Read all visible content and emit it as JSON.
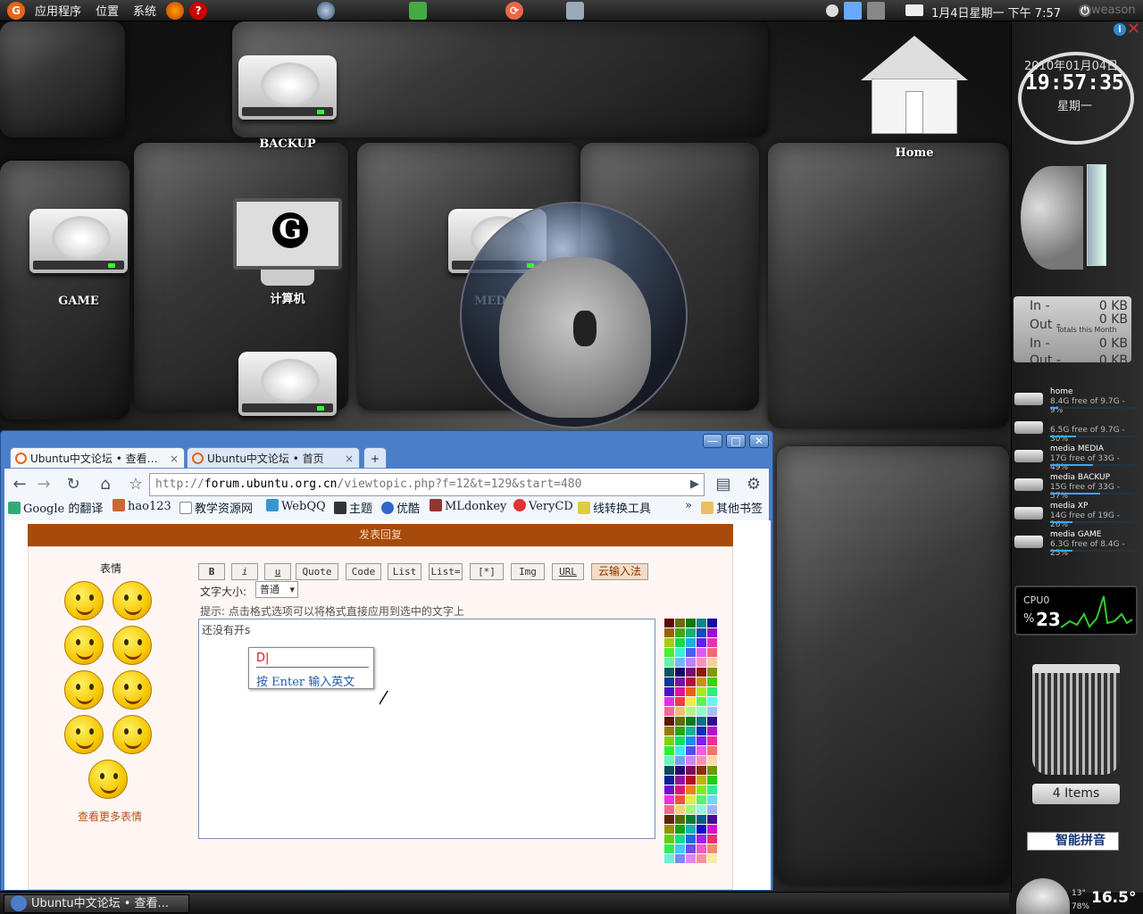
{
  "top_panel": {
    "menus": [
      "应用程序",
      "位置",
      "系统"
    ],
    "clock": "1月4日星期一 下午 7:57",
    "user": "weason"
  },
  "desktop_icons": {
    "backup": "BACKUP",
    "home": "Home",
    "game": "GAME",
    "computer": "计算机",
    "media": "MEDIA"
  },
  "sidebar": {
    "date": "2010年01月04日",
    "time": "19:57:35",
    "weekday": "星期一",
    "net": {
      "in1": "In -",
      "out1": "Out -",
      "in2": "In -",
      "out2": "Out -",
      "v1": "0 KB",
      "v2": "0 KB",
      "v3": "0 KB",
      "v4": "0 KB",
      "totals": "Totals this Month"
    },
    "drives": [
      {
        "name": "home",
        "info": "8.4G free of 9.7G - 9%",
        "usage": 0.09
      },
      {
        "name": "",
        "info": "6.5G free of 9.7G - 30%",
        "usage": 0.3
      },
      {
        "name": "media MEDIA",
        "info": "17G free of 33G - 49%",
        "usage": 0.49
      },
      {
        "name": "media BACKUP",
        "info": "15G free of 33G - 57%",
        "usage": 0.57
      },
      {
        "name": "media XP",
        "info": "14G free of 19G - 26%",
        "usage": 0.26
      },
      {
        "name": "media GAME",
        "info": "6.3G free of 8.4G - 25%",
        "usage": 0.25
      }
    ],
    "cpu_label": "CPU0",
    "cpu_value": "23",
    "cpu_percent_sign": "%",
    "trash_items": "4 Items",
    "ime_status": "智能拼音",
    "weather_small": "13°",
    "weather_humidity": "78%",
    "temperature": "16.5°"
  },
  "browser": {
    "tabs": [
      {
        "label": "Ubuntu中文论坛 • 查看…",
        "close": "×"
      },
      {
        "label": "Ubuntu中文论坛 • 首页",
        "close": "×"
      }
    ],
    "new_tab": "+",
    "window_controls": {
      "minimize": "—",
      "maximize": "□",
      "close": "✕"
    },
    "url_scheme": "http://",
    "url_host": "forum.ubuntu.org.cn",
    "url_path": "/viewtopic.php?f=12&t=129&start=480",
    "bookmarks": [
      "Google 的翻译",
      "hao123",
      "教学资源网",
      "WebQQ",
      "主题",
      "优酷",
      "MLdonkey",
      "VeryCD",
      "线转换工具"
    ],
    "bookmarks_overflow": "»",
    "other_bookmarks": "其他书签"
  },
  "post_form": {
    "header": "发表回复",
    "smilies_title": "表情",
    "more_smilies": "查看更多表情",
    "format_buttons": [
      "B",
      "i",
      "u",
      "Quote",
      "Code",
      "List",
      "List=",
      "[*]",
      "Img",
      "URL",
      "云输入法"
    ],
    "font_size_label": "文字大小:",
    "font_size_value": "普通",
    "hint": "提示: 点击格式选项可以将格式直接应用到选中的文字上",
    "editor_text": "还没有开s"
  },
  "ime_popup": {
    "candidate": "D|",
    "tip": "按 Enter 输入英文"
  },
  "taskbar": {
    "window_label": "Ubuntu中文论坛 • 查看..."
  },
  "colors": {
    "post_header_bg": "#a64b0b",
    "ime_candidate": "#d12",
    "ime_tip": "#235ab0"
  }
}
